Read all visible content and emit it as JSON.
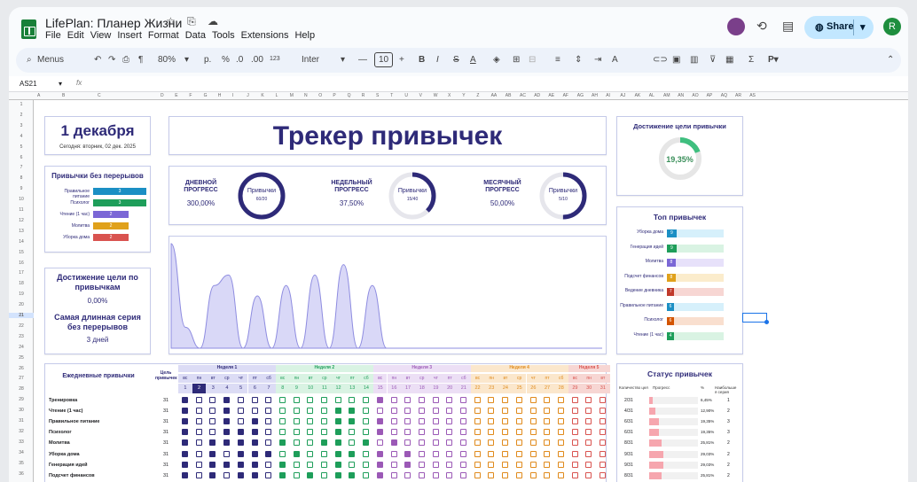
{
  "window": {
    "title": "LifePlan: Планер Жизни",
    "title_icons": "☆ ⎘ ☁"
  },
  "menu": [
    "File",
    "Edit",
    "View",
    "Insert",
    "Format",
    "Data",
    "Tools",
    "Extensions",
    "Help"
  ],
  "header_right": {
    "share_label": "Share",
    "user_initial": "R"
  },
  "toolbar": {
    "menus_label": "Menus",
    "zoom": "80%",
    "currency": "p.",
    "percent": "%",
    "dec_less": ".0",
    "dec_more": ".00",
    "number_format": "123",
    "font": "Inter",
    "font_size": "10"
  },
  "formula": {
    "cell_ref": "AS21",
    "fx": "fx",
    "value": ""
  },
  "columns": [
    "A",
    "B",
    "C",
    "D",
    "E",
    "F",
    "G",
    "H",
    "I",
    "J",
    "K",
    "L",
    "M",
    "N",
    "O",
    "P",
    "Q",
    "R",
    "S",
    "T",
    "U",
    "V",
    "W",
    "X",
    "Y",
    "Z",
    "AA",
    "AB",
    "AC",
    "AD",
    "AE",
    "AF",
    "AG",
    "AH",
    "AI",
    "AJ",
    "AK",
    "AL",
    "AM",
    "AN",
    "AO",
    "AP",
    "AQ",
    "AR",
    "AS"
  ],
  "rows": [
    "1",
    "2",
    "3",
    "4",
    "5",
    "6",
    "7",
    "8",
    "9",
    "10",
    "11",
    "12",
    "13",
    "14",
    "15",
    "16",
    "17",
    "18",
    "19",
    "20",
    "21",
    "22",
    "23",
    "24",
    "25",
    "26",
    "27",
    "28",
    "29",
    "30",
    "31",
    "32",
    "33",
    "34",
    "35",
    "36"
  ],
  "date_card": {
    "date": "1 декабря",
    "today": "Сегодня: вторник, 02 дек. 2025"
  },
  "main_title": "Трекер привычек",
  "progress": [
    {
      "label": "ДНЕВНОЙ\nПРОГРЕСС",
      "value": "300,00%",
      "ring_title": "Привычки",
      "ring_value": "60/20",
      "fraction": 1.0
    },
    {
      "label": "НЕДЕЛЬНЫЙ\nПРОГРЕСС",
      "value": "37,50%",
      "ring_title": "Привычки",
      "ring_value": "15/40",
      "fraction": 0.375
    },
    {
      "label": "МЕСЯЧНЫЙ\nПРОГРЕСС",
      "value": "50,00%",
      "ring_title": "Привычки",
      "ring_value": "5/10",
      "fraction": 0.5
    }
  ],
  "streaks": {
    "title": "Привычки без перерывов",
    "items": [
      {
        "name": "Правильное питание",
        "value": 3,
        "color": "#1b8fc4"
      },
      {
        "name": "Психолог",
        "value": 3,
        "color": "#1e9e5a"
      },
      {
        "name": "Чтение (1 час)",
        "value": 2,
        "color": "#7b67d6"
      },
      {
        "name": "Молитва",
        "value": 2,
        "color": "#e0a11b"
      },
      {
        "name": "Уборка дома",
        "value": 2,
        "color": "#d9534f"
      }
    ]
  },
  "goal_left": {
    "title": "Достижение цели по привычкам",
    "value": "0,00%",
    "streak_title": "Самая длинная серия без перерывов",
    "streak_value": "3 дней"
  },
  "goal_right": {
    "title": "Достижение цели привычки",
    "value": "19,35%",
    "fraction": 0.1935
  },
  "top_habits": {
    "title": "Топ привычек",
    "items": [
      {
        "name": "Уборка дома",
        "value": "9",
        "color": "#1b8fc4",
        "bg": "#d6f0fb"
      },
      {
        "name": "Генерация идей",
        "value": "9",
        "color": "#1e9e5a",
        "bg": "#d9f3e3"
      },
      {
        "name": "Молитва",
        "value": "8",
        "color": "#7b67d6",
        "bg": "#e7e1fa"
      },
      {
        "name": "Подсчет финансов",
        "value": "8",
        "color": "#e0a11b",
        "bg": "#fbeccc"
      },
      {
        "name": "Ведение дневника",
        "value": "7",
        "color": "#c0392b",
        "bg": "#f7d6d3"
      },
      {
        "name": "Правильное питание",
        "value": "6",
        "color": "#1b8fc4",
        "bg": "#d6f0fb"
      },
      {
        "name": "Психолог",
        "value": "6",
        "color": "#d35400",
        "bg": "#f9dfcf"
      },
      {
        "name": "Чтение (1 час)",
        "value": "4",
        "color": "#1e9e5a",
        "bg": "#d9f3e3"
      }
    ]
  },
  "chart_data": {
    "type": "area",
    "title": "",
    "series": [
      {
        "values": [
          10,
          2,
          0,
          6,
          7,
          0,
          5,
          0,
          6,
          0,
          7,
          0,
          8,
          0,
          6,
          0,
          0,
          0,
          0,
          0,
          0,
          0,
          0,
          0,
          0,
          0,
          0,
          0,
          0,
          0,
          0
        ]
      }
    ],
    "color": "#8e8ce0"
  },
  "tracker": {
    "habits_header": "Ежедневные привычки",
    "goal_header": "Цель привычек",
    "weeks": [
      {
        "label": "Неделя 1",
        "color": "#2e2a78",
        "bg": "#dcdcf5"
      },
      {
        "label": "Неделя 2",
        "color": "#1e9e5a",
        "bg": "#d9f3e3"
      },
      {
        "label": "Неделя 3",
        "color": "#9b59b6",
        "bg": "#ecdff5"
      },
      {
        "label": "Неделя 4",
        "color": "#e08a1b",
        "bg": "#fbe7cc"
      },
      {
        "label": "Неделя 5",
        "color": "#d9534f",
        "bg": "#f7d6d3"
      }
    ],
    "weekdays": [
      "вс",
      "пн",
      "вт",
      "ср",
      "чт",
      "пт",
      "сб",
      "вс",
      "пн",
      "вт",
      "ср",
      "чт",
      "пт",
      "сб",
      "вс",
      "пн",
      "вт",
      "ср",
      "чт",
      "пт",
      "сб",
      "вс",
      "пн",
      "вт",
      "ср",
      "чт",
      "пт",
      "сб",
      "вс",
      "пн",
      "вт"
    ],
    "days": [
      "1",
      "2",
      "3",
      "4",
      "5",
      "6",
      "7",
      "8",
      "9",
      "10",
      "11",
      "12",
      "13",
      "14",
      "15",
      "16",
      "17",
      "18",
      "19",
      "20",
      "21",
      "22",
      "23",
      "24",
      "25",
      "26",
      "27",
      "28",
      "29",
      "30",
      "31"
    ],
    "habits": [
      {
        "name": "Тренировка",
        "goal": "31",
        "checks": [
          1,
          0,
          0,
          1,
          0,
          0,
          0,
          0,
          0,
          0,
          0,
          0,
          0,
          0,
          1,
          0,
          0,
          0,
          0,
          0,
          0,
          0,
          0,
          0,
          0,
          0,
          0,
          0,
          0,
          0,
          0
        ]
      },
      {
        "name": "Чтение (1 час)",
        "goal": "31",
        "checks": [
          1,
          0,
          0,
          1,
          0,
          0,
          0,
          0,
          0,
          0,
          0,
          1,
          1,
          0,
          0,
          0,
          0,
          0,
          0,
          0,
          0,
          0,
          0,
          0,
          0,
          0,
          0,
          0,
          0,
          0,
          0
        ]
      },
      {
        "name": "Правильное питание",
        "goal": "31",
        "checks": [
          1,
          0,
          0,
          1,
          0,
          1,
          0,
          0,
          0,
          0,
          0,
          1,
          1,
          0,
          1,
          0,
          0,
          0,
          0,
          0,
          0,
          0,
          0,
          0,
          0,
          0,
          0,
          0,
          0,
          0,
          0
        ]
      },
      {
        "name": "Психолог",
        "goal": "31",
        "checks": [
          1,
          0,
          0,
          1,
          1,
          1,
          0,
          0,
          0,
          0,
          0,
          1,
          0,
          0,
          1,
          0,
          0,
          0,
          0,
          0,
          0,
          0,
          0,
          0,
          0,
          0,
          0,
          0,
          0,
          0,
          0
        ]
      },
      {
        "name": "Молитва",
        "goal": "31",
        "checks": [
          1,
          0,
          1,
          1,
          1,
          1,
          0,
          1,
          0,
          0,
          1,
          1,
          0,
          1,
          0,
          1,
          0,
          0,
          0,
          0,
          0,
          0,
          0,
          0,
          0,
          0,
          0,
          0,
          0,
          0,
          0
        ]
      },
      {
        "name": "Уборка дома",
        "goal": "31",
        "checks": [
          1,
          0,
          1,
          0,
          1,
          1,
          1,
          0,
          1,
          0,
          0,
          1,
          1,
          0,
          1,
          0,
          1,
          0,
          0,
          0,
          0,
          0,
          0,
          0,
          0,
          0,
          0,
          0,
          0,
          0,
          0
        ]
      },
      {
        "name": "Генерация идей",
        "goal": "31",
        "checks": [
          1,
          0,
          1,
          1,
          1,
          1,
          0,
          1,
          0,
          0,
          0,
          1,
          0,
          0,
          1,
          0,
          1,
          0,
          0,
          0,
          0,
          0,
          0,
          0,
          0,
          0,
          0,
          0,
          0,
          0,
          0
        ]
      },
      {
        "name": "Подсчет финансов",
        "goal": "31",
        "checks": [
          1,
          0,
          1,
          0,
          1,
          1,
          0,
          1,
          0,
          1,
          0,
          1,
          1,
          0,
          1,
          0,
          0,
          0,
          0,
          0,
          0,
          0,
          0,
          0,
          0,
          0,
          0,
          0,
          0,
          0,
          0
        ]
      }
    ]
  },
  "status": {
    "title": "Статус привычек",
    "headers": [
      "Количество цел",
      "Прогресс",
      "%",
      "Наибольше\nя серия"
    ],
    "rows": [
      {
        "count": "2/31",
        "pct": "6,45%",
        "streak": "1",
        "fraction": 0.0645
      },
      {
        "count": "4/31",
        "pct": "12,90%",
        "streak": "2",
        "fraction": 0.129
      },
      {
        "count": "6/31",
        "pct": "19,35%",
        "streak": "3",
        "fraction": 0.1935
      },
      {
        "count": "6/31",
        "pct": "19,35%",
        "streak": "3",
        "fraction": 0.1935
      },
      {
        "count": "8/31",
        "pct": "25,81%",
        "streak": "2",
        "fraction": 0.2581
      },
      {
        "count": "9/31",
        "pct": "29,03%",
        "streak": "2",
        "fraction": 0.2903
      },
      {
        "count": "9/31",
        "pct": "29,03%",
        "streak": "2",
        "fraction": 0.2903
      },
      {
        "count": "8/31",
        "pct": "25,81%",
        "streak": "2",
        "fraction": 0.2581
      }
    ]
  }
}
